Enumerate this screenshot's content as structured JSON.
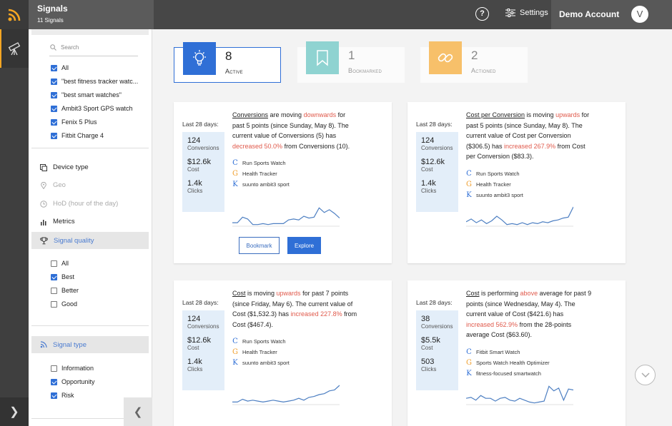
{
  "app": {
    "title": "Signals",
    "subtitle": "11 Signals"
  },
  "header": {
    "help_label": "?",
    "settings_label": "Settings",
    "account_name": "Demo Account",
    "avatar_letter": "V"
  },
  "search": {
    "placeholder": "Search"
  },
  "queries": [
    {
      "label": "All",
      "checked": true
    },
    {
      "label": "\"best fitness tracker watc...",
      "checked": true
    },
    {
      "label": "\"best smart watches\"",
      "checked": true
    },
    {
      "label": "Ambit3 Sport GPS watch",
      "checked": true
    },
    {
      "label": "Fenix 5 Plus",
      "checked": true
    },
    {
      "label": "Fitbit Charge 4",
      "checked": true
    }
  ],
  "dimensions": [
    {
      "label": "Device type",
      "icon": "device-icon",
      "muted": false
    },
    {
      "label": "Geo",
      "icon": "pin-icon",
      "muted": true
    },
    {
      "label": "HoD (hour of the day)",
      "icon": "clock-icon",
      "muted": true
    },
    {
      "label": "Metrics",
      "icon": "bars-icon",
      "muted": false
    }
  ],
  "signal_quality": {
    "label": "Signal quality",
    "options": [
      {
        "label": "All",
        "checked": false
      },
      {
        "label": "Best",
        "checked": true
      },
      {
        "label": "Better",
        "checked": false
      },
      {
        "label": "Good",
        "checked": false
      }
    ]
  },
  "signal_type": {
    "label": "Signal type",
    "options": [
      {
        "label": "Information",
        "checked": false
      },
      {
        "label": "Opportunity",
        "checked": true
      },
      {
        "label": "Risk",
        "checked": true
      }
    ]
  },
  "summary": [
    {
      "count": "8",
      "label": "Active",
      "color": "#2f6fd6"
    },
    {
      "count": "1",
      "label": "Bookmarked",
      "color": "#8fd3d1"
    },
    {
      "count": "2",
      "label": "Actioned",
      "color": "#f7c06a"
    }
  ],
  "cards": [
    {
      "period_label": "Last 28 days:",
      "stats": [
        {
          "value": "124",
          "label": "Conversions"
        },
        {
          "value": "$12.6k",
          "label": "Cost"
        },
        {
          "value": "1.4k",
          "label": "Clicks"
        }
      ],
      "desc": [
        {
          "t": "Conversions",
          "s": "u"
        },
        {
          "t": " are moving ",
          "s": ""
        },
        {
          "t": "downwards",
          "s": "red"
        },
        {
          "t": " for past 5 points (since Sunday, May 8). The current value of Conversions (5) has ",
          "s": ""
        },
        {
          "t": "decreased 50.0%",
          "s": "red"
        },
        {
          "t": " from Conversions (10).",
          "s": ""
        }
      ],
      "keywords": [
        {
          "letter": "C",
          "color": "#2f6fd6",
          "label": "Run Sports Watch"
        },
        {
          "letter": "G",
          "color": "#f0a030",
          "label": "Health Tracker"
        },
        {
          "letter": "K",
          "color": "#2f6fd6",
          "label": "suunto ambit3 sport"
        }
      ],
      "trend": [
        0.15,
        0.15,
        0.45,
        0.35,
        0.05,
        0.05,
        0.1,
        0.05,
        0.1,
        0.1,
        0.1,
        0.3,
        0.35,
        0.3,
        0.5,
        0.4,
        0.45,
        0.95,
        0.7,
        0.85,
        0.65,
        0.4
      ],
      "bookmark_label": "Bookmark",
      "explore_label": "Explore"
    },
    {
      "period_label": "Last 28 days:",
      "stats": [
        {
          "value": "124",
          "label": "Conversions"
        },
        {
          "value": "$12.6k",
          "label": "Cost"
        },
        {
          "value": "1.4k",
          "label": "Clicks"
        }
      ],
      "desc": [
        {
          "t": "Cost per Conversion",
          "s": "u"
        },
        {
          "t": " is moving ",
          "s": ""
        },
        {
          "t": "upwards",
          "s": "red"
        },
        {
          "t": " for past 5 points (since Sunday, May 8). The current value of Cost per Conversion ($306.5) has ",
          "s": ""
        },
        {
          "t": "increased 267.9%",
          "s": "red"
        },
        {
          "t": " from Cost per Conversion ($83.3).",
          "s": ""
        }
      ],
      "keywords": [
        {
          "letter": "C",
          "color": "#2f6fd6",
          "label": "Run Sports Watch"
        },
        {
          "letter": "G",
          "color": "#f0a030",
          "label": "Health Tracker"
        },
        {
          "letter": "K",
          "color": "#2f6fd6",
          "label": "suunto ambit3 sport"
        }
      ],
      "trend": [
        0.2,
        0.35,
        0.15,
        0.3,
        0.1,
        0.25,
        0.5,
        0.3,
        0.05,
        0.1,
        0.05,
        0.15,
        0.05,
        0.15,
        0.1,
        0.2,
        0.15,
        0.25,
        0.3,
        0.4,
        0.45,
        1.0
      ]
    },
    {
      "period_label": "Last 28 days:",
      "stats": [
        {
          "value": "124",
          "label": "Conversions"
        },
        {
          "value": "$12.6k",
          "label": "Cost"
        },
        {
          "value": "1.4k",
          "label": "Clicks"
        }
      ],
      "desc": [
        {
          "t": "Cost",
          "s": "u"
        },
        {
          "t": " is moving ",
          "s": ""
        },
        {
          "t": "upwards",
          "s": "red"
        },
        {
          "t": " for past 7 points (since Friday, May 6). The current value of Cost ($1,532.3) has ",
          "s": ""
        },
        {
          "t": "increased 227.8%",
          "s": "red"
        },
        {
          "t": " from Cost ($467.4).",
          "s": ""
        }
      ],
      "keywords": [
        {
          "letter": "C",
          "color": "#2f6fd6",
          "label": "Run Sports Watch"
        },
        {
          "letter": "G",
          "color": "#f0a030",
          "label": "Health Tracker"
        },
        {
          "letter": "K",
          "color": "#2f6fd6",
          "label": "suunto ambit3 sport"
        }
      ],
      "trend": [
        0.1,
        0.1,
        0.25,
        0.15,
        0.2,
        0.15,
        0.1,
        0.15,
        0.2,
        0.15,
        0.1,
        0.15,
        0.2,
        0.3,
        0.2,
        0.35,
        0.4,
        0.5,
        0.55,
        0.7,
        0.75,
        1.0
      ]
    },
    {
      "period_label": "Last 28 days:",
      "stats": [
        {
          "value": "38",
          "label": "Conversions"
        },
        {
          "value": "$5.5k",
          "label": "Cost"
        },
        {
          "value": "503",
          "label": "Clicks"
        }
      ],
      "desc": [
        {
          "t": "Cost",
          "s": "u"
        },
        {
          "t": " is performing ",
          "s": ""
        },
        {
          "t": "above",
          "s": "red"
        },
        {
          "t": " average for past 9 points (since Wednesday, May 4). The current value of Cost ($421.6) has ",
          "s": ""
        },
        {
          "t": "increased 562.9%",
          "s": "red"
        },
        {
          "t": " from the 28-points average Cost ($63.60).",
          "s": ""
        }
      ],
      "keywords": [
        {
          "letter": "C",
          "color": "#2f6fd6",
          "label": "Fitbit Smart Watch"
        },
        {
          "letter": "G",
          "color": "#f0a030",
          "label": "Sports Watch Health Optimizer"
        },
        {
          "letter": "K",
          "color": "#2f6fd6",
          "label": "fitness-focused smartwatch"
        }
      ],
      "trend": [
        0.3,
        0.35,
        0.2,
        0.45,
        0.3,
        0.3,
        0.15,
        0.3,
        0.35,
        0.2,
        0.15,
        0.3,
        0.2,
        0.1,
        0.05,
        0.1,
        0.15,
        0.95,
        0.7,
        0.85,
        0.2,
        0.8,
        0.75
      ]
    }
  ]
}
